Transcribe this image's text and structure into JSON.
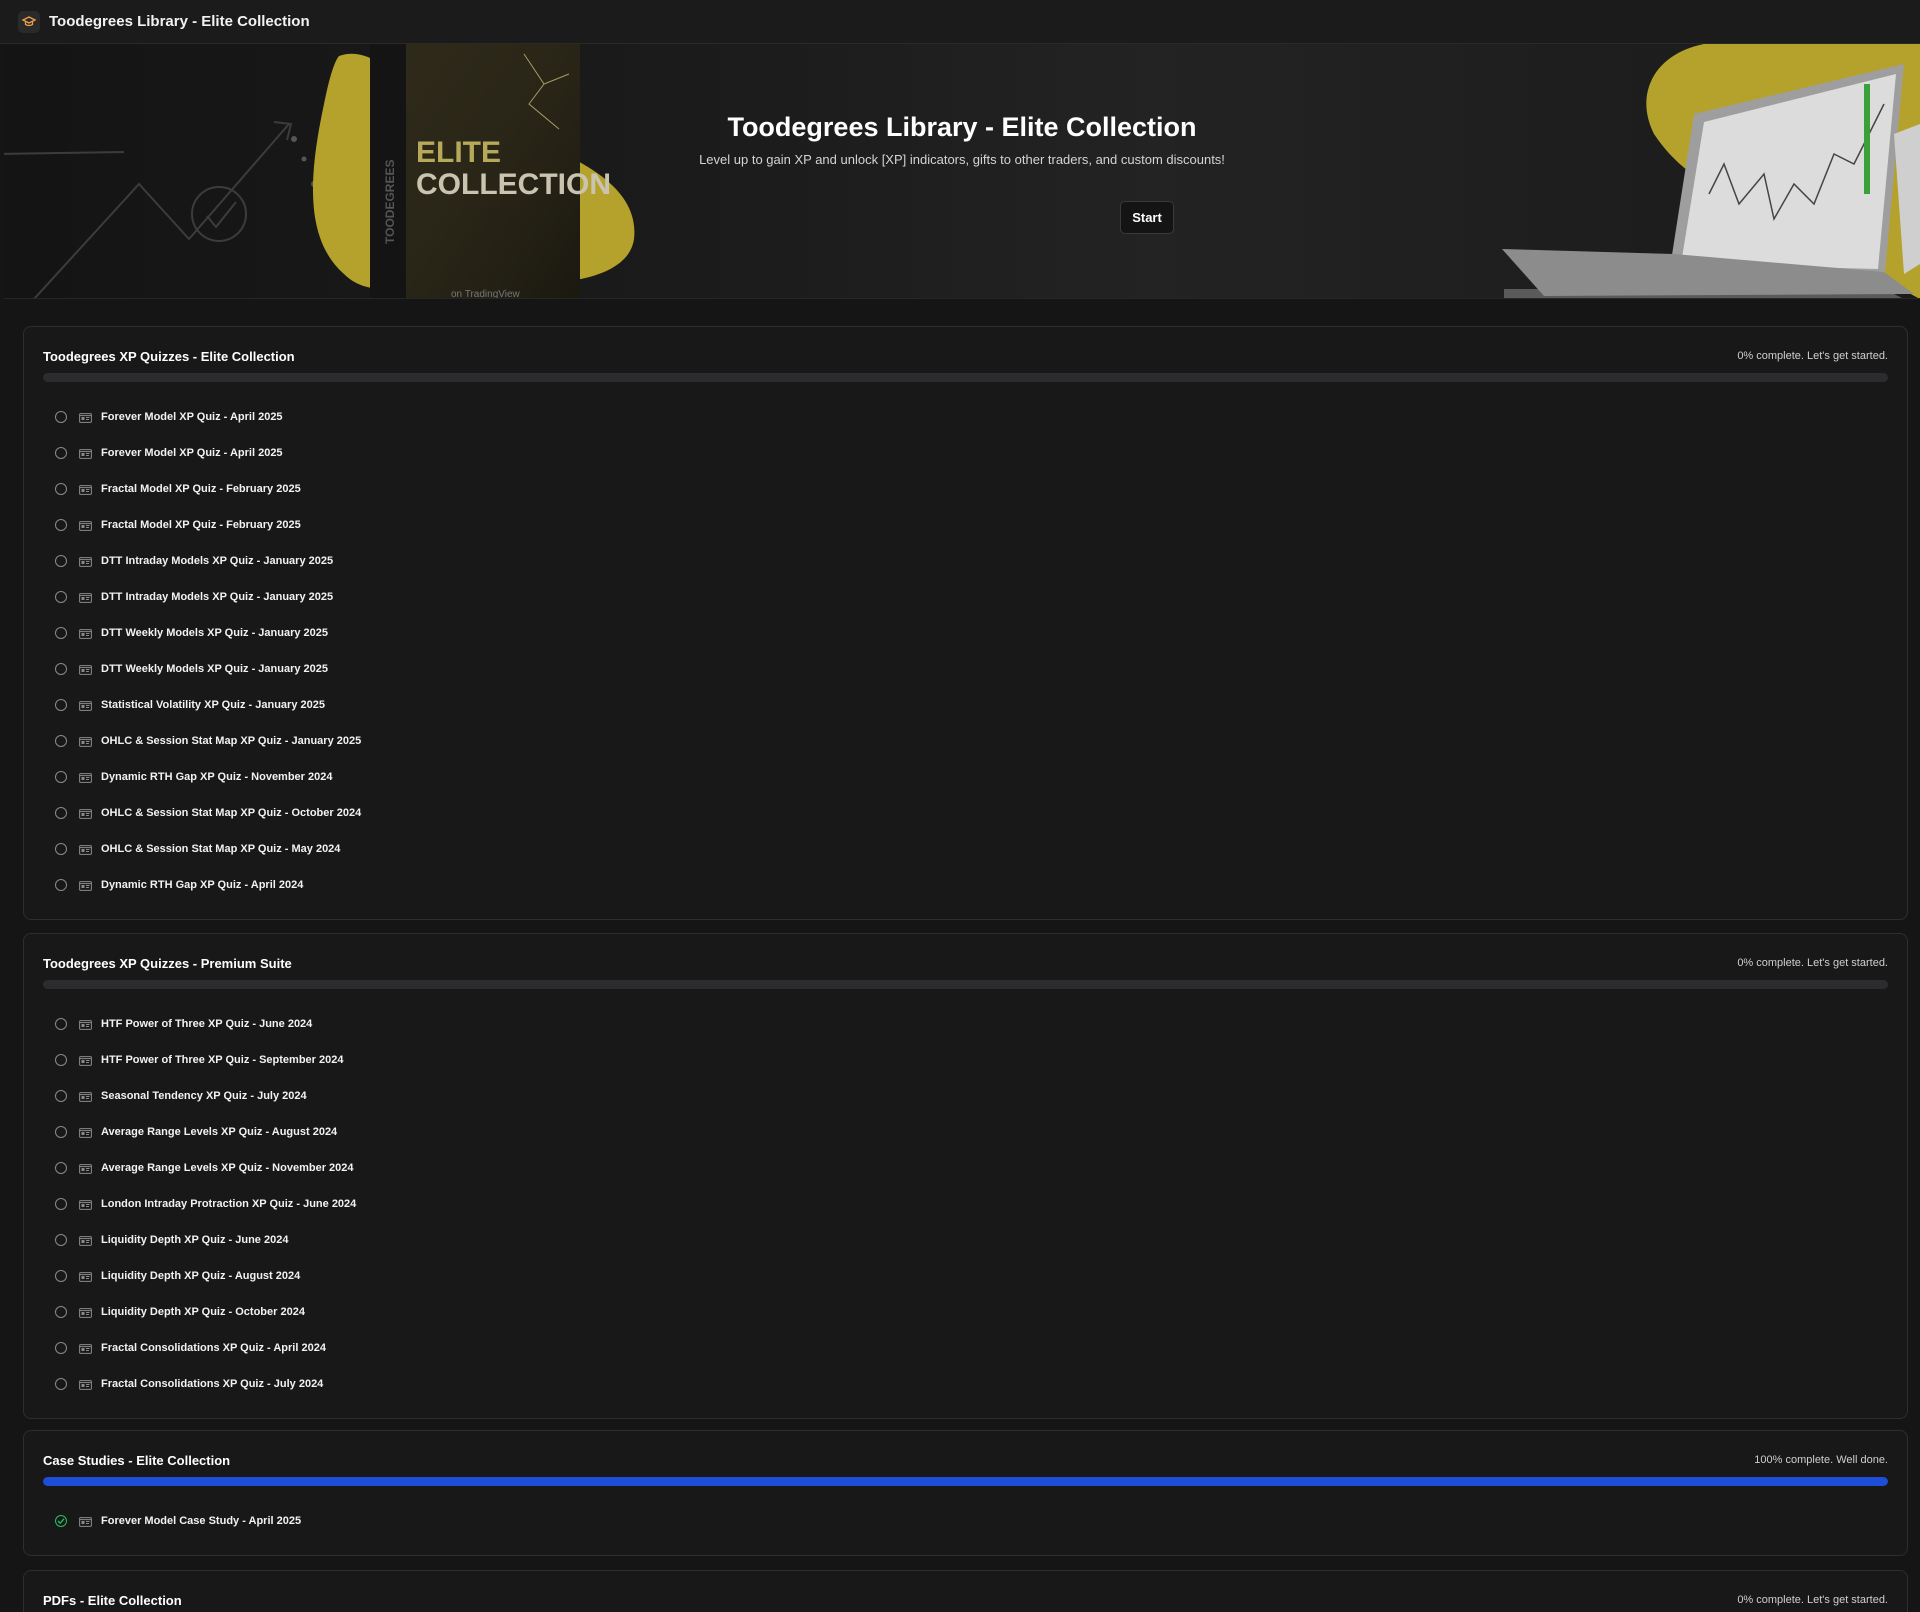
{
  "window": {
    "title": "Toodegrees Library - Elite Collection",
    "icon": "graduation-cap-icon"
  },
  "hero": {
    "title": "Toodegrees Library - Elite Collection",
    "subtitle": "Level up to gain XP and unlock [XP] indicators, gifts to other traders, and custom discounts!",
    "start_label": "Start",
    "product_box_text_line1": "ELITE",
    "product_box_text_line2": "COLLECTION",
    "product_box_side_text": "TOODEGREES",
    "product_box_bottom_text": "on TradingView"
  },
  "colors": {
    "accent": "#1d4ed8",
    "brand_yellow": "#b5a22c",
    "complete": "#22c55e"
  },
  "sections": [
    {
      "title": "Toodegrees XP Quizzes - Elite Collection",
      "status": "0% complete. Let's get started.",
      "progress": 0,
      "items": [
        {
          "label": "Forever Model XP Quiz - April 2025",
          "done": false
        },
        {
          "label": "Forever Model XP Quiz - April 2025",
          "done": false
        },
        {
          "label": "Fractal Model XP Quiz - February 2025",
          "done": false
        },
        {
          "label": "Fractal Model XP Quiz - February 2025",
          "done": false
        },
        {
          "label": "DTT Intraday Models XP Quiz - January 2025",
          "done": false
        },
        {
          "label": "DTT Intraday Models XP Quiz - January 2025",
          "done": false
        },
        {
          "label": "DTT Weekly Models XP Quiz - January 2025",
          "done": false
        },
        {
          "label": "DTT Weekly Models XP Quiz - January 2025",
          "done": false
        },
        {
          "label": "Statistical Volatility XP Quiz - January 2025",
          "done": false
        },
        {
          "label": "OHLC & Session Stat Map XP Quiz - January 2025",
          "done": false
        },
        {
          "label": "Dynamic RTH Gap XP Quiz - November 2024",
          "done": false
        },
        {
          "label": "OHLC & Session Stat Map XP Quiz - October 2024",
          "done": false
        },
        {
          "label": "OHLC & Session Stat Map XP Quiz - May 2024",
          "done": false
        },
        {
          "label": "Dynamic RTH Gap XP Quiz - April 2024",
          "done": false
        }
      ]
    },
    {
      "title": "Toodegrees XP Quizzes - Premium Suite",
      "status": "0% complete. Let's get started.",
      "progress": 0,
      "items": [
        {
          "label": "HTF Power of Three XP Quiz - June 2024",
          "done": false
        },
        {
          "label": "HTF Power of Three XP Quiz - September 2024",
          "done": false
        },
        {
          "label": "Seasonal Tendency XP Quiz - July 2024",
          "done": false
        },
        {
          "label": "Average Range Levels XP Quiz - August 2024",
          "done": false
        },
        {
          "label": "Average Range Levels XP Quiz - November 2024",
          "done": false
        },
        {
          "label": "London Intraday Protraction XP Quiz - June 2024",
          "done": false
        },
        {
          "label": "Liquidity Depth XP Quiz - June 2024",
          "done": false
        },
        {
          "label": "Liquidity Depth XP Quiz - August 2024",
          "done": false
        },
        {
          "label": "Liquidity Depth XP Quiz - October 2024",
          "done": false
        },
        {
          "label": "Fractal Consolidations XP Quiz - April 2024",
          "done": false
        },
        {
          "label": "Fractal Consolidations XP Quiz - July 2024",
          "done": false
        }
      ]
    },
    {
      "title": "Case Studies - Elite Collection",
      "status": "100% complete. Well done.",
      "progress": 100,
      "items": [
        {
          "label": "Forever Model Case Study - April 2025",
          "done": true
        }
      ]
    },
    {
      "title": "PDFs - Elite Collection",
      "status": "0% complete. Let's get started.",
      "progress": 0,
      "items": []
    }
  ]
}
